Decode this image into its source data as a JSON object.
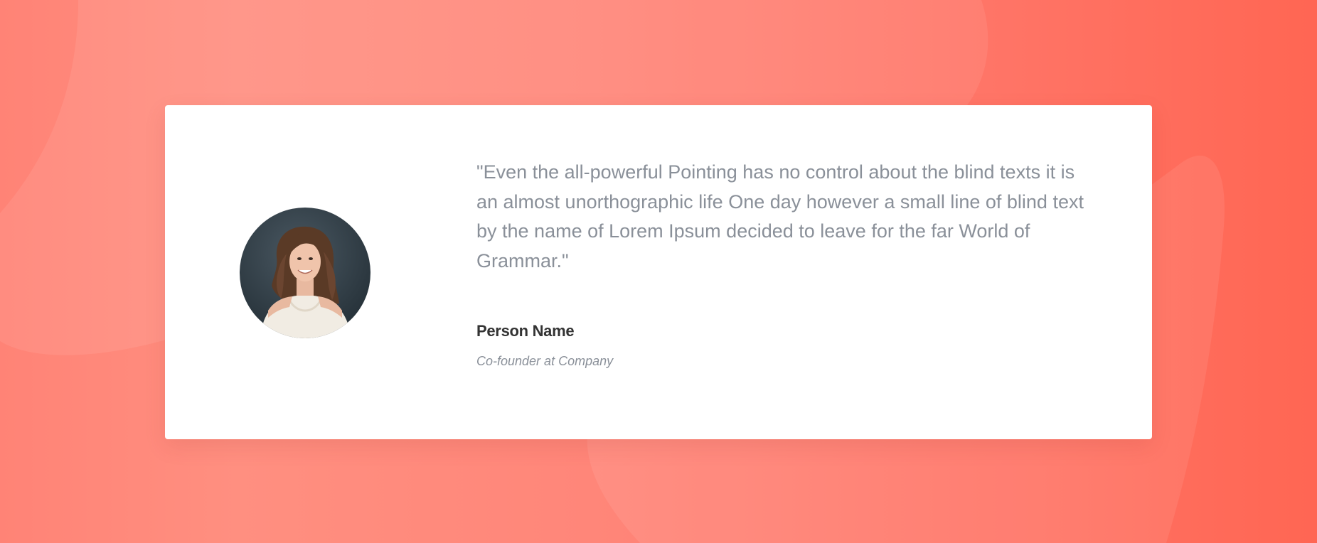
{
  "testimonial": {
    "quote": "\"Even the all-powerful Pointing has no control about the blind texts it is an almost unorthographic life One day however a small line of blind text by the name of Lorem Ipsum decided to leave for the far World of Grammar.\"",
    "name": "Person Name",
    "role": "Co-founder at Company"
  },
  "colors": {
    "background_start": "#ff8376",
    "background_end": "#ff6653",
    "card": "#ffffff",
    "quote_text": "#8a9099",
    "name_text": "#333333"
  }
}
